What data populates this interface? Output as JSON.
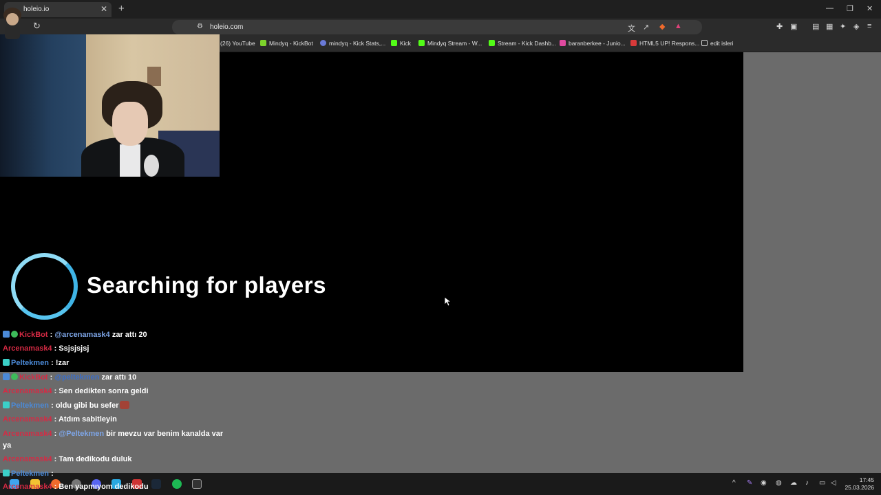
{
  "browser": {
    "tab_title": "holeio.io",
    "url": "holeio.com",
    "bookmarks": [
      {
        "label": "(26) YouTube",
        "color": "#e02020"
      },
      {
        "label": "Mindyq - KickBot",
        "color": "#7dd32b"
      },
      {
        "label": "mindyq - Kick Stats,...",
        "color": "#6a7ad8"
      },
      {
        "label": "Kick",
        "color": "#53fc18"
      },
      {
        "label": "Mindyq Stream - W...",
        "color": "#53fc18"
      },
      {
        "label": "Stream - Kick Dashb...",
        "color": "#53fc18"
      },
      {
        "label": "baranberkee - Junio...",
        "color": "#e04aa0"
      },
      {
        "label": "HTML5 UP! Respons...",
        "color": "#d83a3a"
      },
      {
        "label": "edit isleri",
        "color": "#cccccc"
      }
    ]
  },
  "game": {
    "status_text": "Searching for players"
  },
  "chat": {
    "messages": [
      {
        "user": "KickBot",
        "user_style": "red",
        "sep": " : ",
        "mention": "@arcenamask4",
        "text": " zar attı 20",
        "badges": true
      },
      {
        "user": "Arcenamask4",
        "user_style": "red",
        "sep": " : ",
        "mention": "",
        "text": "Ssjsjsjsj",
        "badges": false
      },
      {
        "user": "Peltekmen",
        "user_style": "blue",
        "sep": " : ",
        "mention": "",
        "text": "!zar",
        "badges": true
      },
      {
        "user": "KickBot",
        "user_style": "red",
        "sep": " : ",
        "mention": "@peltekmen",
        "text": " zar attı 10",
        "badges": true
      },
      {
        "user": "Arcenamask4",
        "user_style": "red",
        "sep": " : ",
        "mention": "",
        "text": "Sen dedikten sonra geldi",
        "badges": false
      },
      {
        "user": "Peltekmen",
        "user_style": "blue",
        "sep": " : ",
        "mention": "",
        "text": "oldu gibi bu sefer",
        "badges": true
      },
      {
        "user": "Arcenamask4",
        "user_style": "red",
        "sep": " : ",
        "mention": "",
        "text": "Atdım sabitleyin",
        "badges": false
      },
      {
        "user": "Arcenamask4",
        "user_style": "red",
        "sep": " : ",
        "mention": "@Peltekmen",
        "text": " bir mevzu var benim kanalda var",
        "badges": false
      },
      {
        "user": "",
        "user_style": "none",
        "sep": "",
        "mention": "",
        "text": "ya",
        "badges": false
      },
      {
        "user": "Arcenamask4",
        "user_style": "red",
        "sep": " : ",
        "mention": "",
        "text": "Tam dedikodu duluk",
        "badges": false
      },
      {
        "user": "Peltekmen",
        "user_style": "blue",
        "sep": " : ",
        "mention": "",
        "text": "",
        "badges": true
      },
      {
        "user": "Arcenamask4",
        "user_style": "red",
        "sep": " : ",
        "mention": "",
        "text": "Ben yapmıyom dedikodu",
        "badges": false
      }
    ]
  },
  "taskbar": {
    "time": "17:45",
    "date": "25.03.2026"
  }
}
